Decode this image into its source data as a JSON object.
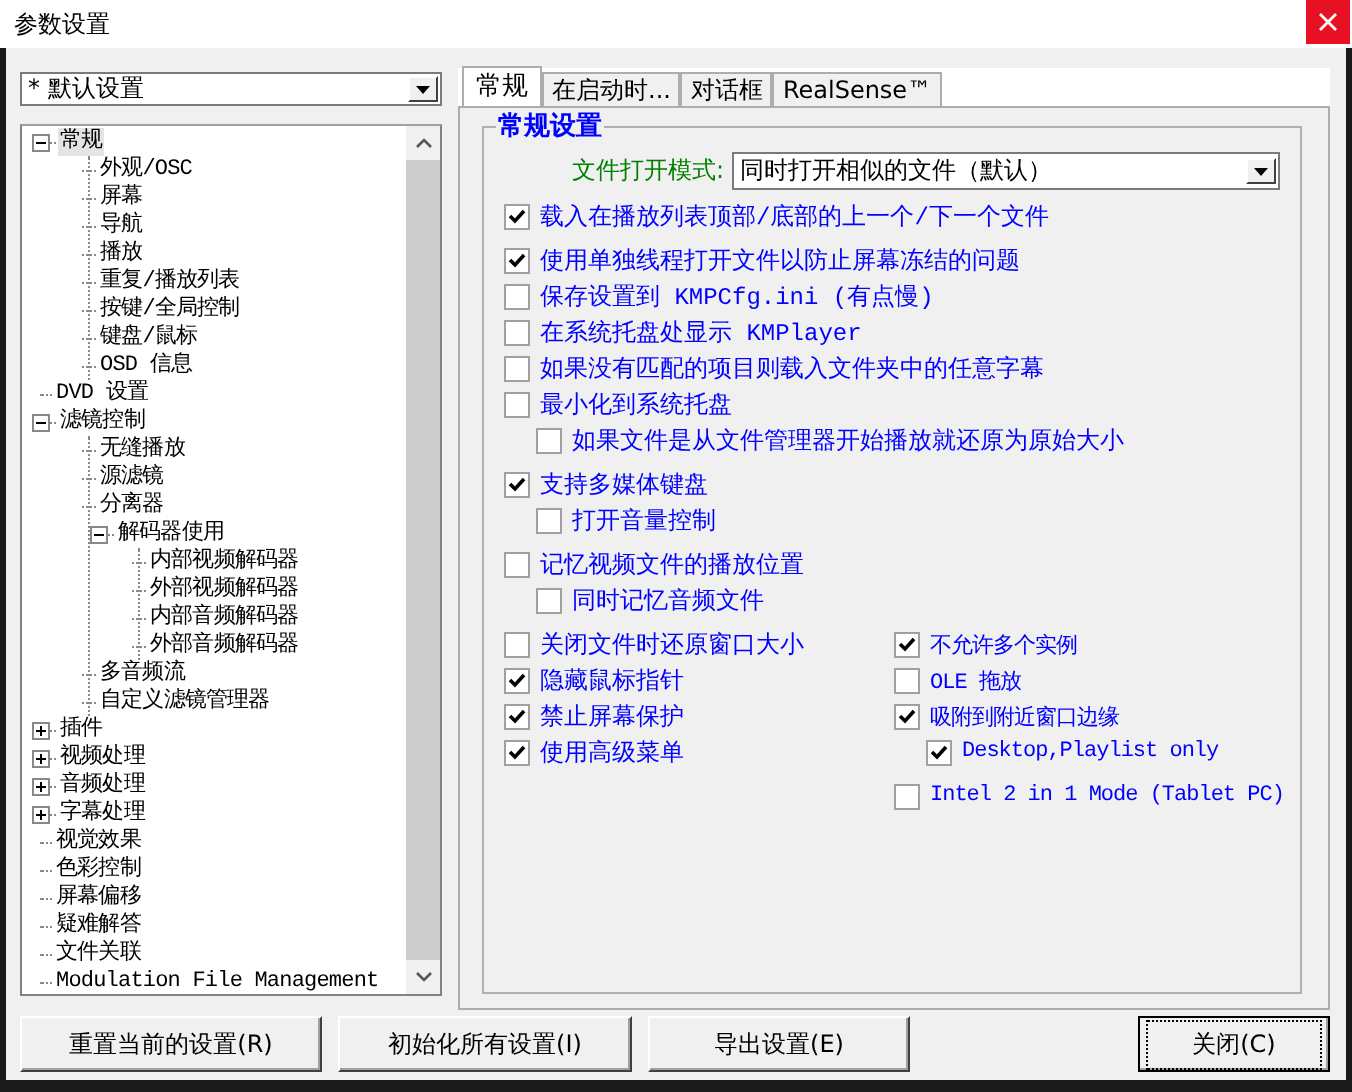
{
  "window": {
    "title": "参数设置"
  },
  "profile_select": {
    "value": "* 默认设置"
  },
  "tree": [
    {
      "label": "常规",
      "selected": true,
      "expanded": true,
      "children": [
        {
          "label": "外观/OSC",
          "selected": false
        },
        {
          "label": "屏幕",
          "selected": false
        },
        {
          "label": "导航",
          "selected": false
        },
        {
          "label": "播放",
          "selected": false
        },
        {
          "label": "重复/播放列表",
          "selected": false
        },
        {
          "label": "按键/全局控制",
          "selected": false
        },
        {
          "label": "键盘/鼠标",
          "selected": false
        },
        {
          "label": "OSD 信息",
          "selected": false
        }
      ]
    },
    {
      "label": "DVD 设置",
      "selected": false
    },
    {
      "label": "滤镜控制",
      "selected": false,
      "expanded": true,
      "children": [
        {
          "label": "无缝播放",
          "selected": false
        },
        {
          "label": "源滤镜",
          "selected": false
        },
        {
          "label": "分离器",
          "selected": false
        },
        {
          "label": "解码器使用",
          "selected": false,
          "expanded": true,
          "children": [
            {
              "label": "内部视频解码器",
              "selected": false
            },
            {
              "label": "外部视频解码器",
              "selected": false
            },
            {
              "label": "内部音频解码器",
              "selected": false
            },
            {
              "label": "外部音频解码器",
              "selected": false
            }
          ]
        },
        {
          "label": "多音频流",
          "selected": false
        },
        {
          "label": "自定义滤镜管理器",
          "selected": false
        }
      ]
    },
    {
      "label": "插件",
      "selected": false,
      "expanded": false
    },
    {
      "label": "视频处理",
      "selected": false,
      "expanded": false
    },
    {
      "label": "音频处理",
      "selected": false,
      "expanded": false
    },
    {
      "label": "字幕处理",
      "selected": false,
      "expanded": false
    },
    {
      "label": "视觉效果",
      "selected": false
    },
    {
      "label": "色彩控制",
      "selected": false
    },
    {
      "label": "屏幕偏移",
      "selected": false
    },
    {
      "label": "疑难解答",
      "selected": false
    },
    {
      "label": "文件关联",
      "selected": false
    },
    {
      "label": "Modulation File Management",
      "selected": false
    }
  ],
  "tabs": [
    {
      "label": "常规",
      "selected": true
    },
    {
      "label": "在启动时...",
      "selected": false
    },
    {
      "label": "对话框",
      "selected": false
    },
    {
      "label": "RealSense™",
      "selected": false
    }
  ],
  "group": {
    "title": "常规设置",
    "open_mode": {
      "label": "文件打开模式:",
      "value": "同时打开相似的文件（默认）"
    },
    "option_groups": [
      [
        {
          "label": "载入在播放列表顶部/底部的上一个/下一个文件",
          "checked": true
        }
      ],
      [
        {
          "label": "使用单独线程打开文件以防止屏幕冻结的问题",
          "checked": true
        },
        {
          "label": "保存设置到 KMPCfg.ini (有点慢)",
          "checked": false
        },
        {
          "label": "在系统托盘处显示 KMPlayer",
          "checked": false
        },
        {
          "label": "如果没有匹配的项目则载入文件夹中的任意字幕",
          "checked": false
        },
        {
          "label": "最小化到系统托盘",
          "checked": false,
          "children": [
            {
              "label": "如果文件是从文件管理器开始播放就还原为原始大小",
              "checked": false
            }
          ]
        }
      ],
      [
        {
          "label": "支持多媒体键盘",
          "checked": true,
          "children": [
            {
              "label": "打开音量控制",
              "checked": false
            }
          ]
        }
      ],
      [
        {
          "label": "记忆视频文件的播放位置",
          "checked": false,
          "children": [
            {
              "label": "同时记忆音频文件",
              "checked": false
            }
          ]
        }
      ]
    ],
    "left_column": [
      {
        "label": "关闭文件时还原窗口大小",
        "checked": false
      },
      {
        "label": "隐藏鼠标指针",
        "checked": true
      },
      {
        "label": "禁止屏幕保护",
        "checked": true
      },
      {
        "label": "使用高级菜单",
        "checked": true
      }
    ],
    "right_column": [
      {
        "label": "不允许多个实例",
        "checked": true
      },
      {
        "label": "OLE 拖放",
        "checked": false
      },
      {
        "label": "吸附到附近窗口边缘",
        "checked": true,
        "children": [
          {
            "label": "Desktop,Playlist only",
            "checked": true
          }
        ]
      },
      {
        "label": "Intel 2 in 1 Mode (Tablet PC)",
        "checked": false
      }
    ]
  },
  "buttons": [
    {
      "label": "重置当前的设置(R)",
      "default": false
    },
    {
      "label": "初始化所有设置(I)",
      "default": false
    },
    {
      "label": "导出设置(E)",
      "default": false
    },
    {
      "label": "关闭(C)",
      "default": true
    }
  ]
}
